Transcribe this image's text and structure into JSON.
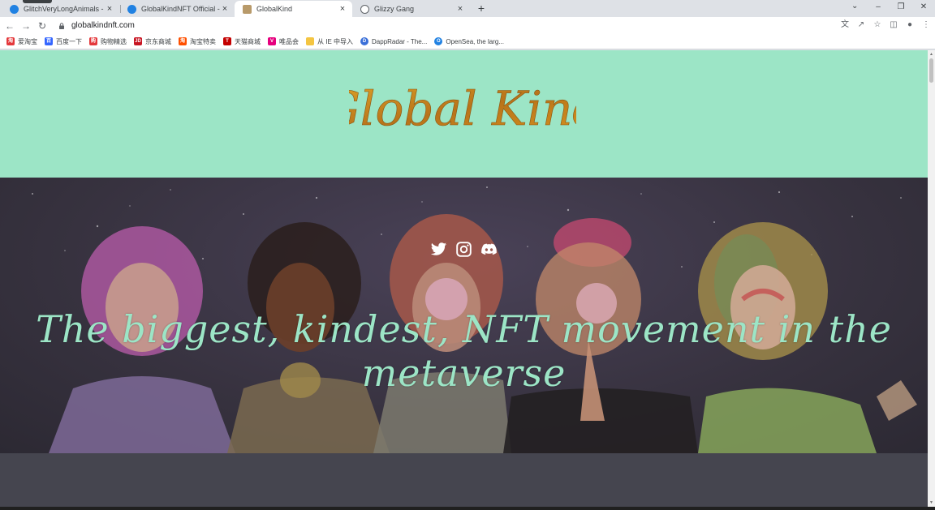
{
  "browser": {
    "tabs": [
      {
        "label": "GlitchVeryLongAnimals - Colle",
        "favicon_color": "#2081e2",
        "active": false
      },
      {
        "label": "GlobalKindNFT Official - Colle",
        "favicon_color": "#2081e2",
        "active": false
      },
      {
        "label": "GlobalKind",
        "favicon_color": "#b89a6a",
        "active": true
      },
      {
        "label": "Glizzy Gang",
        "favicon_color": "#5f6368",
        "active": false
      }
    ],
    "new_tab_glyph": "+",
    "close_glyph": "×",
    "url": "globalkindnft.com",
    "bookmarks": [
      {
        "label": "爱淘宝",
        "icon_color": "#e4393c",
        "icon_text": "淘"
      },
      {
        "label": "百度一下",
        "icon_color": "#3466ff",
        "icon_text": "百"
      },
      {
        "label": "购物精选",
        "icon_color": "#e4393c",
        "icon_text": "购"
      },
      {
        "label": "京东商城",
        "icon_color": "#c81623",
        "icon_text": "JD"
      },
      {
        "label": "淘宝特卖",
        "icon_color": "#ff5000",
        "icon_text": "淘"
      },
      {
        "label": "天猫商城",
        "icon_color": "#c40000",
        "icon_text": "T"
      },
      {
        "label": "唯品会",
        "icon_color": "#e6007e",
        "icon_text": "V"
      },
      {
        "label": "从 IE 中导入",
        "icon_color": "#f4c542",
        "icon_text": ""
      },
      {
        "label": "DappRadar - The...",
        "icon_color": "#3a6fd8",
        "icon_text": "D"
      },
      {
        "label": "OpenSea, the larg...",
        "icon_color": "#2081e2",
        "icon_text": "O"
      }
    ]
  },
  "site": {
    "logo_text": "Global Kind",
    "tagline": "The biggest, kindest, NFT movement in the metaverse",
    "social_icons": [
      "twitter-icon",
      "instagram-icon",
      "discord-icon"
    ],
    "colors": {
      "mint": "#9ce5c6",
      "gold": "#c98a1c",
      "hero_bg": "#37323f",
      "lower_bg": "#45454f"
    }
  }
}
